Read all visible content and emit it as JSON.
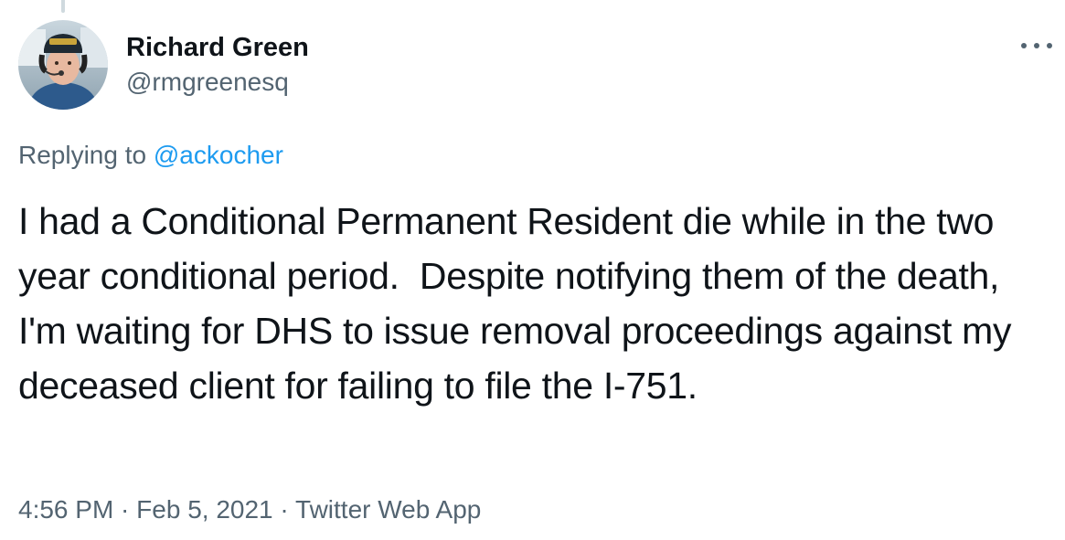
{
  "tweet": {
    "author": {
      "display_name": "Richard Green",
      "handle": "@rmgreenesq",
      "avatar_icon": "profile-photo-pilot-headset"
    },
    "more_icon": "more-horizontal-icon",
    "replying_prefix": "Replying to ",
    "replying_to": "@ackocher",
    "text": "I had a Conditional Permanent Resident die while in the two year conditional period.  Despite notifying them of the death, I'm waiting for DHS to issue removal proceedings against my deceased client for failing to file the I-751.",
    "time": "4:56 PM",
    "separator": " · ",
    "date": "Feb 5, 2021",
    "source": "Twitter Web App"
  },
  "colors": {
    "text_primary": "#0f1419",
    "text_secondary": "#536471",
    "link": "#1d9bf0",
    "thread_line": "#cfd9de"
  }
}
